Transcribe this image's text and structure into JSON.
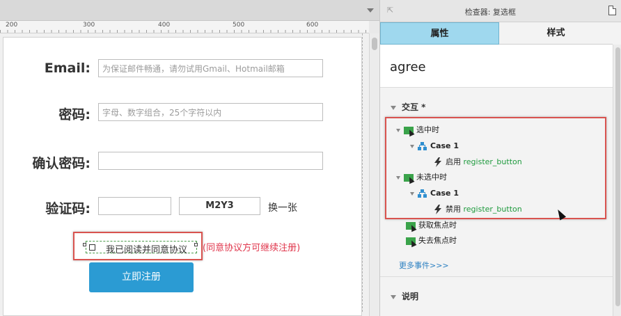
{
  "canvas": {
    "ruler_marks": [
      "200",
      "300",
      "400",
      "500",
      "600"
    ]
  },
  "form": {
    "email": {
      "label": "Email:",
      "placeholder": "为保证邮件畅通，请勿试用Gmail、Hotmail邮箱"
    },
    "password": {
      "label": "密码:",
      "placeholder": "字母、数字组合，25个字符以内"
    },
    "confirm_password": {
      "label": "确认密码:",
      "placeholder": ""
    },
    "captcha": {
      "label": "验证码:",
      "value": "",
      "code": "M2Y3",
      "refresh_text": "换一张"
    },
    "agree": {
      "checkbox_label": "我已阅读并同意协议",
      "hint": "(同意协议方可继续注册)"
    },
    "register_button": "立即注册"
  },
  "inspector": {
    "title": "检查器: 复选框",
    "tabs": {
      "properties": "属性",
      "style": "样式"
    },
    "widget_name": "agree",
    "interactions_title": "交互 *",
    "events": {
      "on_checked": {
        "name": "选中时",
        "case": "Case 1",
        "action_verb": "启用",
        "action_target": "register_button"
      },
      "on_unchecked": {
        "name": "未选中时",
        "case": "Case 1",
        "action_verb": "禁用",
        "action_target": "register_button"
      },
      "on_focus": "获取焦点时",
      "on_blur": "失去焦点时"
    },
    "more_events": "更多事件>>>",
    "notes_title": "说明"
  },
  "colors": {
    "accent_tab": "#9fd8ee",
    "button_blue": "#2b9bd3",
    "highlight_red": "#d9534f",
    "hint_red": "#e0364c",
    "action_green": "#1e9a3d",
    "link_blue": "#2a7fc1"
  }
}
